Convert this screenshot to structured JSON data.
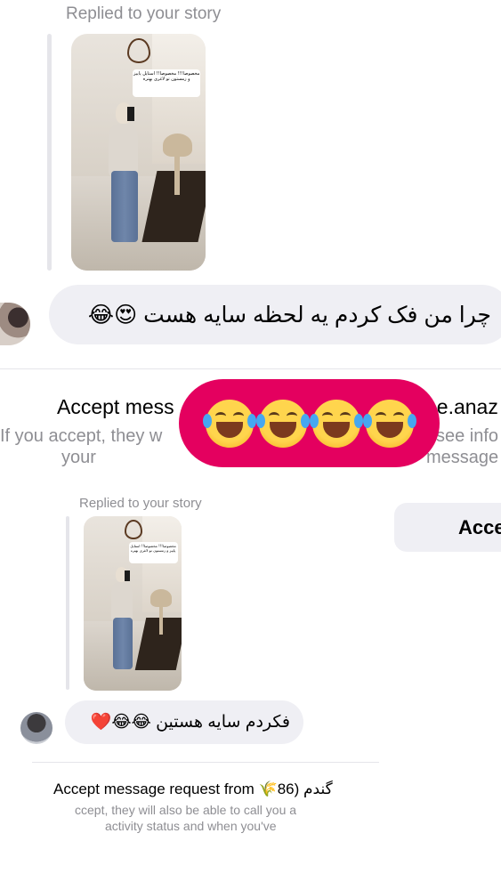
{
  "top": {
    "replied_label": "Replied to your story",
    "story_sticker_text": "مخصوصا!!! مخصوصا!! استایل پاییز و زمستون تو لاغری بهتره",
    "message_text": "چرا من فک کردم یه لحظه سایه هست 😍😂",
    "accept_text_left": "Accept mess",
    "accept_text_right": "ne.anaz",
    "info_left": "If you accept, they w",
    "info_right": "see info",
    "info2_left": "your",
    "info2_right": "message",
    "accept_button_label": "Accep"
  },
  "reaction": {
    "emojis": [
      "😂",
      "😂",
      "😂",
      "😂"
    ],
    "color": "#e4005f"
  },
  "bottom": {
    "replied_label": "Replied to your story",
    "story_sticker_text": "مخصوصا!!! مخصوصا!! استایل پاییز و زمستون تو لاغری بهتره",
    "message_text": "فکردم سایه هستین 😂😂❤️",
    "accept_text": "Accept message request from 🌾گندم (86",
    "info_line1": "ccept, they will also be able to call you a",
    "info_line2": "activity status and when you've"
  },
  "icons": {
    "avatar_top": "avatar",
    "avatar_bottom": "avatar"
  }
}
